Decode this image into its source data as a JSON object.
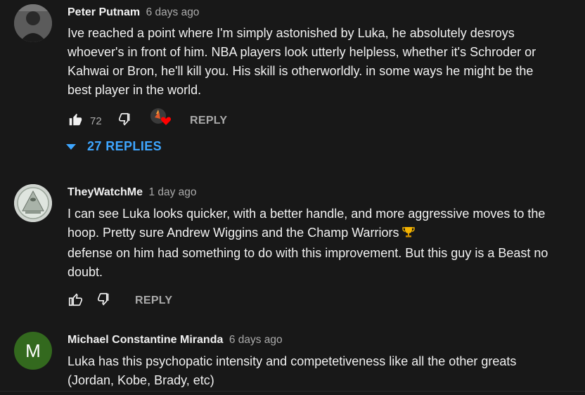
{
  "comments": [
    {
      "author": "Peter Putnam",
      "time": "6 days ago",
      "text": "Ive reached a point where I'm simply astonished by Luka, he absolutely desroys whoever's in front of him. NBA players look utterly helpless, whether it's Schroder or Kahwai or Bron, he'll kill you. His skill is otherworldly. in some ways he might be the best player in the world.",
      "likes": "72",
      "reply_label": "REPLY",
      "replies_label": "27 REPLIES"
    },
    {
      "author": "TheyWatchMe",
      "time": "1 day ago",
      "text_line1": "I can see Luka looks quicker,  with a better handle, and more aggressive moves to the hoop. Pretty sure Andrew Wiggins and the  Champ Warriors",
      "text_line2": "defense on him had something to do with this improvement. But this guy is a Beast no doubt.",
      "reply_label": "REPLY"
    },
    {
      "author": "Michael Constantine Miranda",
      "time": "6 days ago",
      "avatar_letter": "M",
      "text": "Luka has this psychopatic intensity and competetiveness like all the other greats (Jordan, Kobe, Brady, etc)"
    }
  ],
  "colors": {
    "background": "#181818",
    "link_blue": "#3ea6ff",
    "avatar_green": "#33691e",
    "muted": "#aaaaaa"
  },
  "icons": [
    "thumb-up-filled-icon",
    "thumb-down-icon",
    "creator-heart-icon",
    "caret-down-icon",
    "thumb-up-outline-icon",
    "trophy-icon"
  ]
}
